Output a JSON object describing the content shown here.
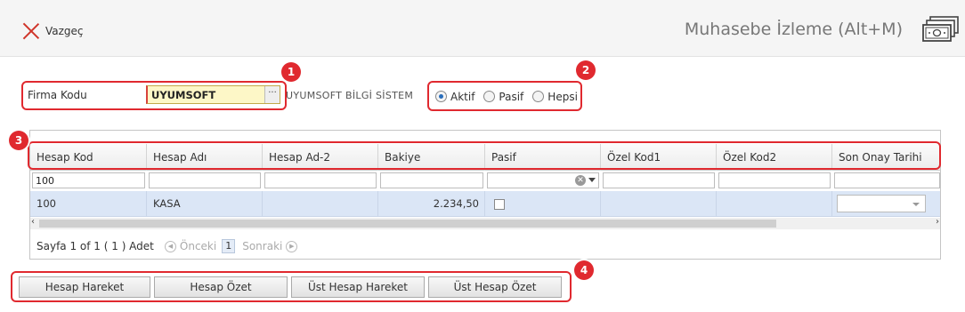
{
  "header": {
    "cancel_label": "Vazgeç",
    "title": "Muhasebe İzleme (Alt+M)",
    "icon": "money-stack-icon"
  },
  "filter": {
    "firma_label": "Firma Kodu",
    "firma_value": "UYUMSOFT",
    "lookup_button": "···",
    "company_name": "UYUMSOFT BİLGİ SİSTEM",
    "radios": [
      {
        "label": "Aktif",
        "checked": true
      },
      {
        "label": "Pasif",
        "checked": false
      },
      {
        "label": "Hepsi",
        "checked": false
      }
    ]
  },
  "grid": {
    "columns": [
      "Hesap Kod",
      "Hesap Adı",
      "Hesap Ad-2",
      "Bakiye",
      "Pasif",
      "Özel Kod1",
      "Özel Kod2",
      "Son Onay Tarihi"
    ],
    "filter_hesap_kod": "100",
    "rows": [
      {
        "hesap_kod": "100",
        "hesap_adi": "KASA",
        "hesap_ad2": "",
        "bakiye": "2.234,50",
        "pasif": false,
        "ozel_kod1": "",
        "ozel_kod2": "",
        "son_onay": ""
      }
    ],
    "pager": {
      "summary": "Sayfa 1 of 1 ( 1 ) Adet",
      "prev": "Önceki",
      "page": "1",
      "next": "Sonraki"
    }
  },
  "buttons": [
    "Hesap Hareket",
    "Hesap Özet",
    "Üst Hesap Hareket",
    "Üst Hesap Özet"
  ],
  "callouts": [
    "1",
    "2",
    "3",
    "4"
  ],
  "colors": {
    "callout": "#e0292f",
    "selected_row": "#dbe6f6",
    "required_field": "#fdf7c7"
  }
}
